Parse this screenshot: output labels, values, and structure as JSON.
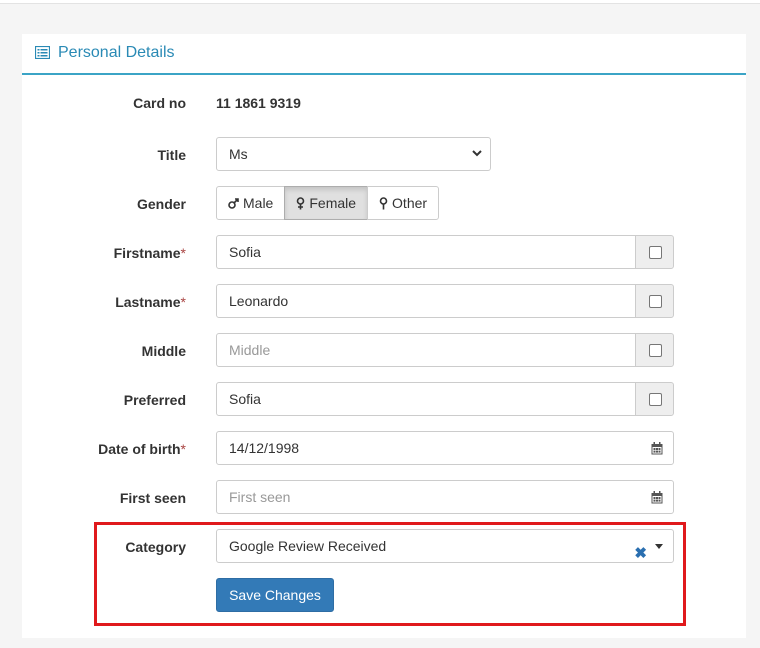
{
  "panel": {
    "title": "Personal Details"
  },
  "fields": {
    "card_no": {
      "label": "Card no",
      "value": "11 1861 9319"
    },
    "title": {
      "label": "Title",
      "value": "Ms"
    },
    "gender": {
      "label": "Gender",
      "options": [
        "Male",
        "Female",
        "Other"
      ],
      "selected": "Female"
    },
    "firstname": {
      "label": "Firstname",
      "required": "*",
      "value": "Sofia"
    },
    "lastname": {
      "label": "Lastname",
      "required": "*",
      "value": "Leonardo"
    },
    "middle": {
      "label": "Middle",
      "placeholder": "Middle"
    },
    "preferred": {
      "label": "Preferred",
      "value": "Sofia"
    },
    "dob": {
      "label": "Date of birth",
      "required": "*",
      "value": "14/12/1998"
    },
    "first_seen": {
      "label": "First seen",
      "placeholder": "First seen"
    },
    "category": {
      "label": "Category",
      "value": "Google Review Received"
    }
  },
  "actions": {
    "save_label": "Save Changes"
  },
  "colors": {
    "accent": "#2a8ab5",
    "primary": "#337ab7",
    "highlight": "#e0191c"
  },
  "icons": {
    "panel": "list-icon",
    "calendar": "calendar-icon",
    "clear": "clear-x-icon"
  }
}
